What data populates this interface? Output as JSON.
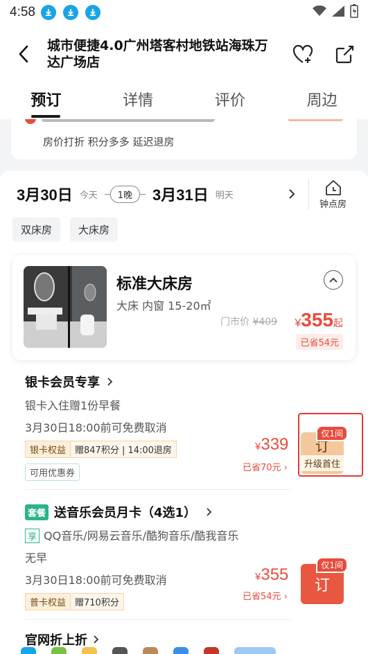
{
  "status": {
    "time": "4:58"
  },
  "header": {
    "title": "城市便捷4.0广州塔客村地铁站海珠万达广场店"
  },
  "tabs": [
    "预订",
    "详情",
    "评价",
    "周边"
  ],
  "promo": {
    "subtext": "房价打折 积分多多 延迟退房"
  },
  "dates": {
    "checkin": "3月30日",
    "checkin_label": "今天",
    "nights": "1晚",
    "checkout": "3月31日",
    "checkout_label": "明天",
    "hourly_label": "钟点房"
  },
  "filters": [
    "双床房",
    "大床房"
  ],
  "room": {
    "name": "标准大床房",
    "spec": "大床 内窗 15-20㎡",
    "orig_label": "门市价",
    "orig_price": "¥409",
    "currency": "¥",
    "price": "355",
    "price_suffix": "起",
    "saved": "已省54元"
  },
  "plans": [
    {
      "title": "银卡会员专享",
      "line1": "银卡入住赠1份早餐",
      "line2": "3月30日18:00前可免费取消",
      "tag_a": "银卡权益",
      "tag_b": "赠847积分 | 14:00退房",
      "coupon": "可用优惠券",
      "currency": "¥",
      "price": "339",
      "saved": "已省70元",
      "book": "订",
      "book_sub": "升级首住",
      "only": "仅1间"
    },
    {
      "badge": "套餐",
      "title": "送音乐会员月卡（4选1）",
      "xiang": "享",
      "line1": "QQ音乐/网易云音乐/酷狗音乐/酷我音乐",
      "line_meal": "无早",
      "line2": "3月30日18:00前可免费取消",
      "tag_a": "普卡权益",
      "tag_b": "赠710积分",
      "currency": "¥",
      "price": "355",
      "saved": "已省54元",
      "book": "订",
      "only": "仅1间"
    }
  ],
  "next_section": {
    "title": "官网折上折"
  },
  "colors": {
    "accent": "#e84c3d",
    "green": "#2bb38a",
    "status_blue": "#1aa4e8"
  }
}
